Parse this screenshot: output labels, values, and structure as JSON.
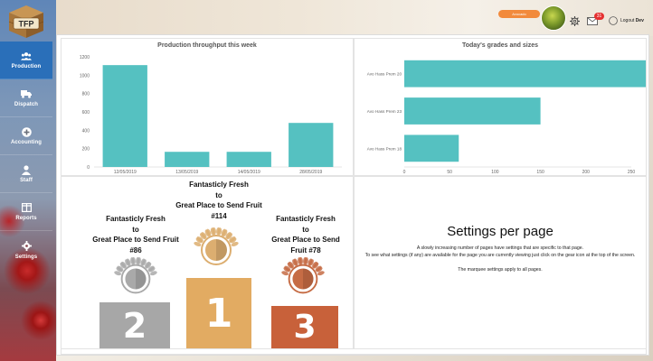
{
  "header": {
    "account_label": "Avocado",
    "mail_count": "31",
    "logout_label": "Logout",
    "user_name": "Dev"
  },
  "logo": {
    "text": "TFP"
  },
  "sidebar": {
    "items": [
      {
        "label": "Production",
        "icon": "users-icon",
        "active": true
      },
      {
        "label": "Dispatch",
        "icon": "truck-icon"
      },
      {
        "label": "Accounting",
        "icon": "plus-circle-icon"
      },
      {
        "label": "Staff",
        "icon": "user-icon"
      },
      {
        "label": "Reports",
        "icon": "columns-icon"
      },
      {
        "label": "Settings",
        "icon": "gear-icon"
      }
    ]
  },
  "charts": {
    "throughput_title": "Production throughput this week",
    "grades_title": "Today's grades and sizes"
  },
  "chart_data": [
    {
      "type": "bar",
      "title": "Production throughput this week",
      "categories": [
        "12/05/2019",
        "13/05/2019",
        "14/05/2019",
        "28/05/2019"
      ],
      "values": [
        1110,
        165,
        165,
        480
      ],
      "ylim": [
        0,
        1200
      ],
      "yticks": [
        "0",
        "200",
        "400",
        "600",
        "800",
        "1000",
        "1200"
      ],
      "color": "#55c1c1",
      "grid": false
    },
    {
      "type": "bar",
      "orientation": "horizontal",
      "title": "Today's grades and sizes",
      "categories": [
        "Avo Hass Prem 20",
        "Avo Hass Prem 23",
        "Avo Hass Prem 18"
      ],
      "values": [
        275,
        150,
        60
      ],
      "xlim": [
        0,
        250
      ],
      "xticks": [
        "0",
        "50",
        "100",
        "150",
        "200",
        "250"
      ],
      "color": "#55c1c1",
      "grid": false
    }
  ],
  "podium": {
    "first": {
      "lines": [
        "Fantasticly Fresh",
        "to",
        "Great Place to Send Fruit",
        "#114"
      ],
      "rank": "1",
      "color": "#e2ab62",
      "medal": "#dcae70"
    },
    "second": {
      "lines": [
        "Fantasticly Fresh",
        "to",
        "Great Place to Send Fruit",
        "#86"
      ],
      "rank": "2",
      "color": "#a7a7a7",
      "medal": "#a9a9a9"
    },
    "third": {
      "lines": [
        "Fantasticly Fresh",
        "to",
        "Great Place to Send",
        "Fruit #78"
      ],
      "rank": "3",
      "color": "#c8613a",
      "medal": "#c66c45"
    }
  },
  "settings_info": {
    "title": "Settings per page",
    "para1": "A slowly increasing number of pages have settings that are specific to that page.",
    "para2": "To see what settings (if any) are available for the page you are currently viewing just click on the gear icon at the top of the screen.",
    "para3": "The marquee settings apply to all pages."
  }
}
